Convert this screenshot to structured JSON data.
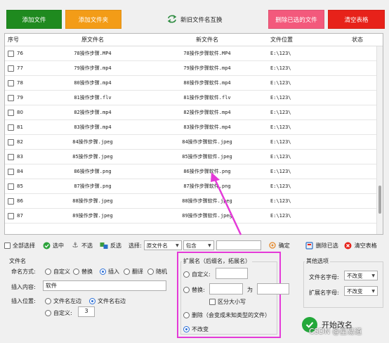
{
  "top_buttons": {
    "add_file": "添加文件",
    "add_folder": "添加文件夹",
    "swap": "新旧文件名互换",
    "delete_selected": "删除已选的文件",
    "clear_table": "清空表格"
  },
  "colors": {
    "add_file": "#1f8a1f",
    "add_folder": "#f39c17",
    "delete_selected": "#f3597c",
    "clear_table": "#e7221a",
    "highlight": "#e43ad8"
  },
  "table": {
    "headers": [
      "序号",
      "原文件名",
      "新文件名",
      "文件位置",
      "状态"
    ],
    "rows": [
      {
        "no": "76",
        "orig": "78操作步骤.MP4",
        "new": "78操作步骤软件.MP4",
        "loc": "E:\\123\\",
        "status": ""
      },
      {
        "no": "77",
        "orig": "79操作步骤.mp4",
        "new": "79操作步骤软件.mp4",
        "loc": "E:\\123\\",
        "status": ""
      },
      {
        "no": "78",
        "orig": "80操作步骤.mp4",
        "new": "80操作步骤软件.mp4",
        "loc": "E:\\123\\",
        "status": ""
      },
      {
        "no": "79",
        "orig": "81操作步骤.flv",
        "new": "81操作步骤软件.flv",
        "loc": "E:\\123\\",
        "status": ""
      },
      {
        "no": "80",
        "orig": "82操作步骤.mp4",
        "new": "82操作步骤软件.mp4",
        "loc": "E:\\123\\",
        "status": ""
      },
      {
        "no": "81",
        "orig": "83操作步骤.mp4",
        "new": "83操作步骤软件.mp4",
        "loc": "E:\\123\\",
        "status": ""
      },
      {
        "no": "82",
        "orig": "84操作步骤.jpeg",
        "new": "84操作步骤软件.jpeg",
        "loc": "E:\\123\\",
        "status": ""
      },
      {
        "no": "83",
        "orig": "85操作步骤.jpeg",
        "new": "85操作步骤软件.jpeg",
        "loc": "E:\\123\\",
        "status": ""
      },
      {
        "no": "84",
        "orig": "86操作步骤.png",
        "new": "86操作步骤软件.png",
        "loc": "E:\\123\\",
        "status": ""
      },
      {
        "no": "85",
        "orig": "87操作步骤.png",
        "new": "87操作步骤软件.png",
        "loc": "E:\\123\\",
        "status": ""
      },
      {
        "no": "86",
        "orig": "88操作步骤.jpeg",
        "new": "88操作步骤软件.jpeg",
        "loc": "E:\\123\\",
        "status": ""
      },
      {
        "no": "87",
        "orig": "89操作步骤.jpeg",
        "new": "89操作步骤软件.jpeg",
        "loc": "E:\\123\\",
        "status": ""
      }
    ]
  },
  "toolbar": {
    "select_all": "全部选择",
    "select": "选中",
    "unselect": "不选",
    "invert": "反选",
    "choose_label": "选择:",
    "field_value": "原文件名",
    "match_value": "包含",
    "match_text": "",
    "confirm": "确定",
    "delete_selected": "删除已选",
    "clear_table": "清空表格"
  },
  "filename_group": {
    "title": "文件名",
    "mode_label": "命名方式:",
    "modes": [
      "自定义",
      "替换",
      "插入",
      "翻译",
      "随机"
    ],
    "selected_mode": "插入",
    "insert_label": "插入内容:",
    "insert_value": "软件",
    "position_label": "插入位置:",
    "positions": [
      "文件名左边",
      "文件名右边",
      "自定义:"
    ],
    "selected_position": "文件名右边",
    "custom_position_value": "3"
  },
  "ext_group": {
    "title": "扩展名（后缀名，拓展名）",
    "custom_label": "自定义:",
    "custom_value": "",
    "replace_label": "替换:",
    "replace_from": "",
    "to_label": "为",
    "replace_to": "",
    "case_label": "区分大小写",
    "delete_label": "删除（会变成未知类型的文件）",
    "keep_label": "不改变",
    "selected": "不改变"
  },
  "other_group": {
    "title": "其他选项",
    "filename_case_label": "文件名字母:",
    "filename_case_value": "不改变",
    "ext_case_label": "扩展名字母:",
    "ext_case_value": "不改变"
  },
  "start": {
    "label": "开始改名"
  },
  "watermark": "CSDN @星易道",
  "icons": [
    "refresh-swap-icon",
    "check-circle-icon",
    "anchor-icon",
    "invert-icon",
    "confirm-icon",
    "delete-icon",
    "clear-icon",
    "start-icon"
  ]
}
